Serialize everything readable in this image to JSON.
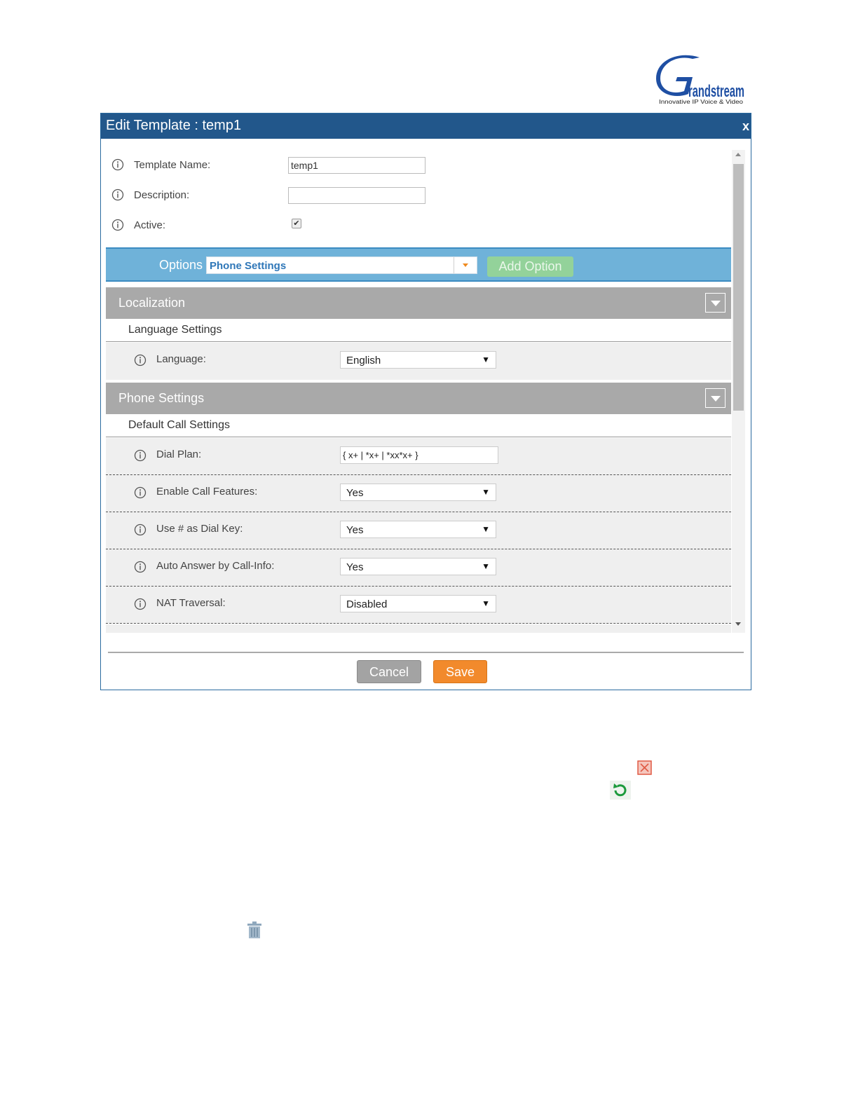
{
  "logo": {
    "brand": "randstream",
    "tagline": "Innovative IP Voice & Video"
  },
  "dialog": {
    "title": "Edit Template : temp1",
    "close_label": "x",
    "general": {
      "template_name_label": "Template Name:",
      "template_name_value": "temp1",
      "description_label": "Description:",
      "description_value": "",
      "active_label": "Active:",
      "active_checked": true
    },
    "options": {
      "label": "Options",
      "selected": "Phone Settings",
      "add_button": "Add Option"
    },
    "sections": {
      "localization": {
        "title": "Localization",
        "subsection": "Language Settings",
        "language_label": "Language:",
        "language_value": "English"
      },
      "phone_settings": {
        "title": "Phone Settings",
        "subsection": "Default Call Settings",
        "dial_plan_label": "Dial Plan:",
        "dial_plan_value": "{ x+ | *x+ | *xx*x+ }",
        "enable_call_features_label": "Enable Call Features:",
        "enable_call_features_value": "Yes",
        "use_hash_label": "Use # as Dial Key:",
        "use_hash_value": "Yes",
        "auto_answer_label": "Auto Answer by Call-Info:",
        "auto_answer_value": "Yes",
        "nat_label": "NAT Traversal:",
        "nat_value": "Disabled"
      }
    },
    "buttons": {
      "cancel": "Cancel",
      "save": "Save"
    }
  },
  "icons": {
    "info": "info-icon",
    "delete_option": "red-close-icon",
    "reset": "refresh-icon",
    "trash": "trash-icon"
  },
  "colors": {
    "titlebar": "#22578b",
    "options_bar": "#6fb2d9",
    "add_option": "#93d29a",
    "section_header": "#a9a9a9",
    "save": "#f28a2c",
    "cancel": "#a3a3a3"
  }
}
